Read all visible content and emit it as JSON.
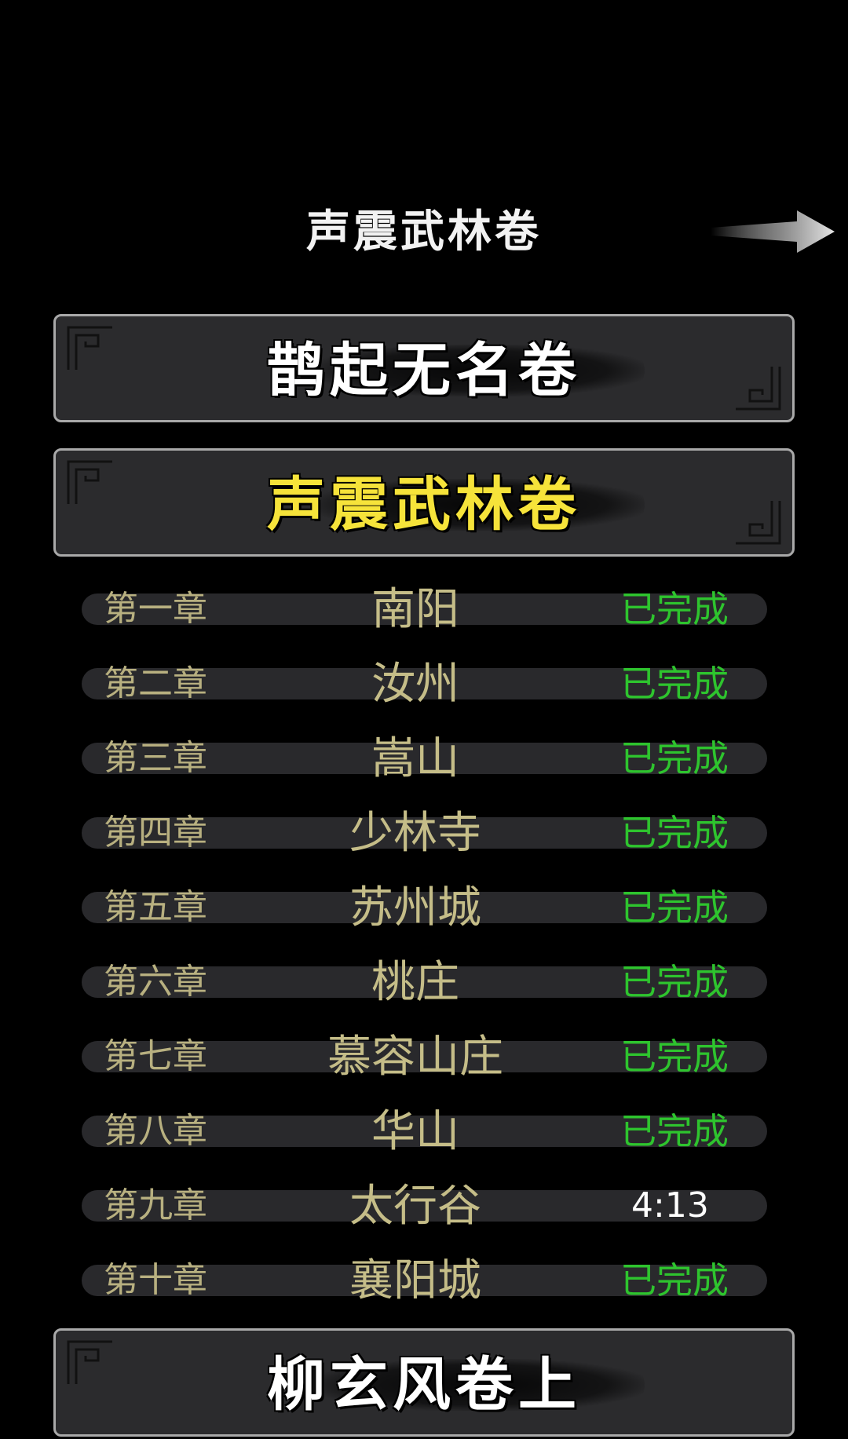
{
  "header": {
    "title": "声震武林卷",
    "next_icon": "arrow-right-icon"
  },
  "volumes": [
    {
      "label": "鹊起无名卷",
      "active": false
    },
    {
      "label": "声震武林卷",
      "active": true
    },
    {
      "label": "柳玄风卷上",
      "active": false
    }
  ],
  "chapters": [
    {
      "num": "第一章",
      "name": "南阳",
      "status": "已完成"
    },
    {
      "num": "第二章",
      "name": "汝州",
      "status": "已完成"
    },
    {
      "num": "第三章",
      "name": "嵩山",
      "status": "已完成"
    },
    {
      "num": "第四章",
      "name": "少林寺",
      "status": "已完成"
    },
    {
      "num": "第五章",
      "name": "苏州城",
      "status": "已完成"
    },
    {
      "num": "第六章",
      "name": "桃庄",
      "status": "已完成"
    },
    {
      "num": "第七章",
      "name": "慕容山庄",
      "status": "已完成"
    },
    {
      "num": "第八章",
      "name": "华山",
      "status": "已完成"
    },
    {
      "num": "第九章",
      "name": "太行谷",
      "status": "4:13"
    },
    {
      "num": "第十章",
      "name": "襄阳城",
      "status": "已完成"
    }
  ],
  "colors": {
    "background": "#000000",
    "active_volume": "#f6e33a",
    "completed": "#2ec42e",
    "chapter_text": "#c5bd88"
  }
}
